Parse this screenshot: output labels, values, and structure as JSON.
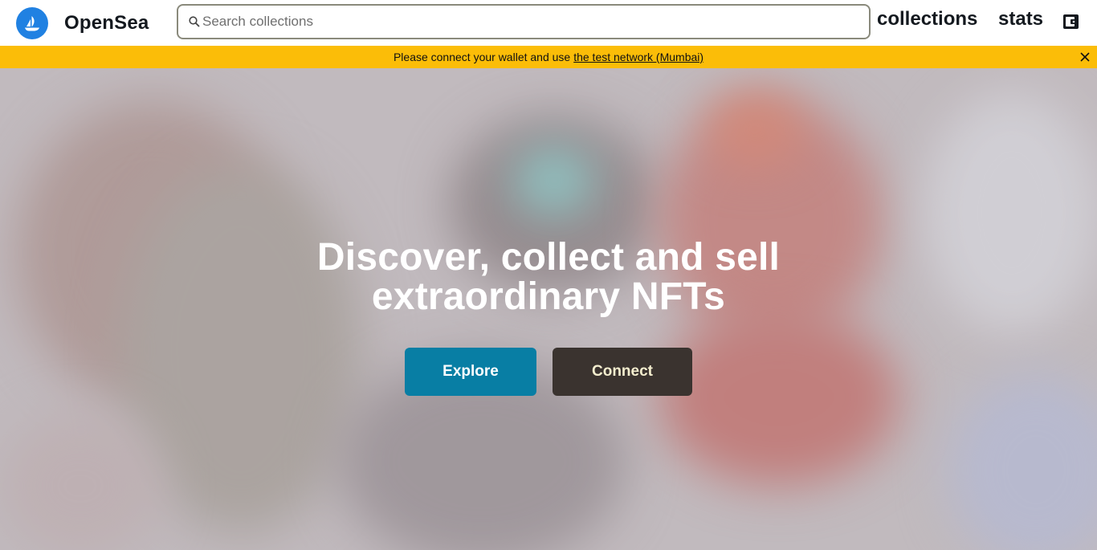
{
  "brand": {
    "name": "OpenSea"
  },
  "header": {
    "search_placeholder": "Search collections",
    "nav": [
      {
        "label": "collections"
      },
      {
        "label": "stats"
      }
    ],
    "wallet_icon": "wallet-icon"
  },
  "banner": {
    "text": "Please connect your wallet and use",
    "link": "the test network (Mumbai)",
    "close_icon": "close-icon",
    "color": "#fbbd08"
  },
  "hero": {
    "title_line1": "Discover, collect and sell",
    "title_line2": "extraordinary NFTs",
    "explore_label": "Explore",
    "connect_label": "Connect",
    "explore_color": "#087ea4",
    "connect_color": "#3a332f"
  }
}
